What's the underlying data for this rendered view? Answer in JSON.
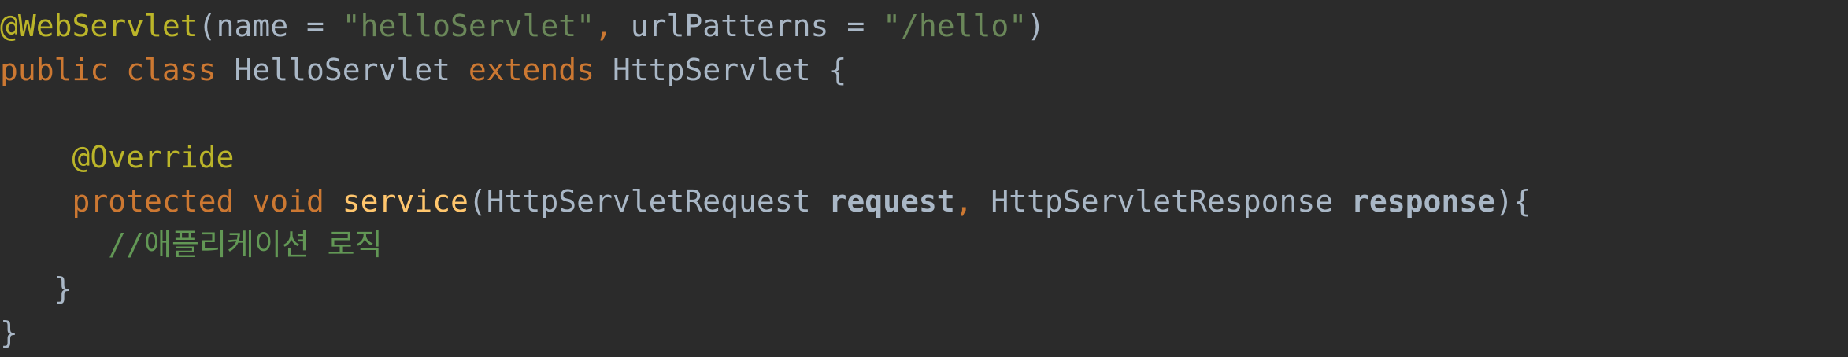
{
  "code": {
    "line1": {
      "annotation": "@WebServlet",
      "open_paren": "(",
      "name_key": "name = ",
      "name_value": "\"helloServlet\"",
      "comma": ", ",
      "url_key": "urlPatterns = ",
      "url_value": "\"/hello\"",
      "close_paren": ")"
    },
    "line2": {
      "kw_public": "public",
      "kw_class": "class",
      "class_name": "HelloServlet",
      "kw_extends": "extends",
      "parent_class": "HttpServlet",
      "brace": "{"
    },
    "line4": {
      "annotation": "@Override"
    },
    "line5": {
      "kw_protected": "protected",
      "kw_void": "void",
      "method_name": "service",
      "open_paren": "(",
      "req_type": "HttpServletRequest",
      "req_param": "request",
      "comma": ",",
      "res_type": "HttpServletResponse",
      "res_param": "response",
      "close": "){"
    },
    "line6": {
      "comment": "//애플리케이션 로직"
    },
    "line7": {
      "brace": "}"
    },
    "line8": {
      "brace": "}"
    }
  },
  "colors": {
    "background": "#2b2b2b",
    "keyword": "#cc7832",
    "annotation": "#bbb529",
    "string": "#6a8759",
    "method": "#ffc66d",
    "plain": "#a9b7c6",
    "comment": "#629755"
  }
}
